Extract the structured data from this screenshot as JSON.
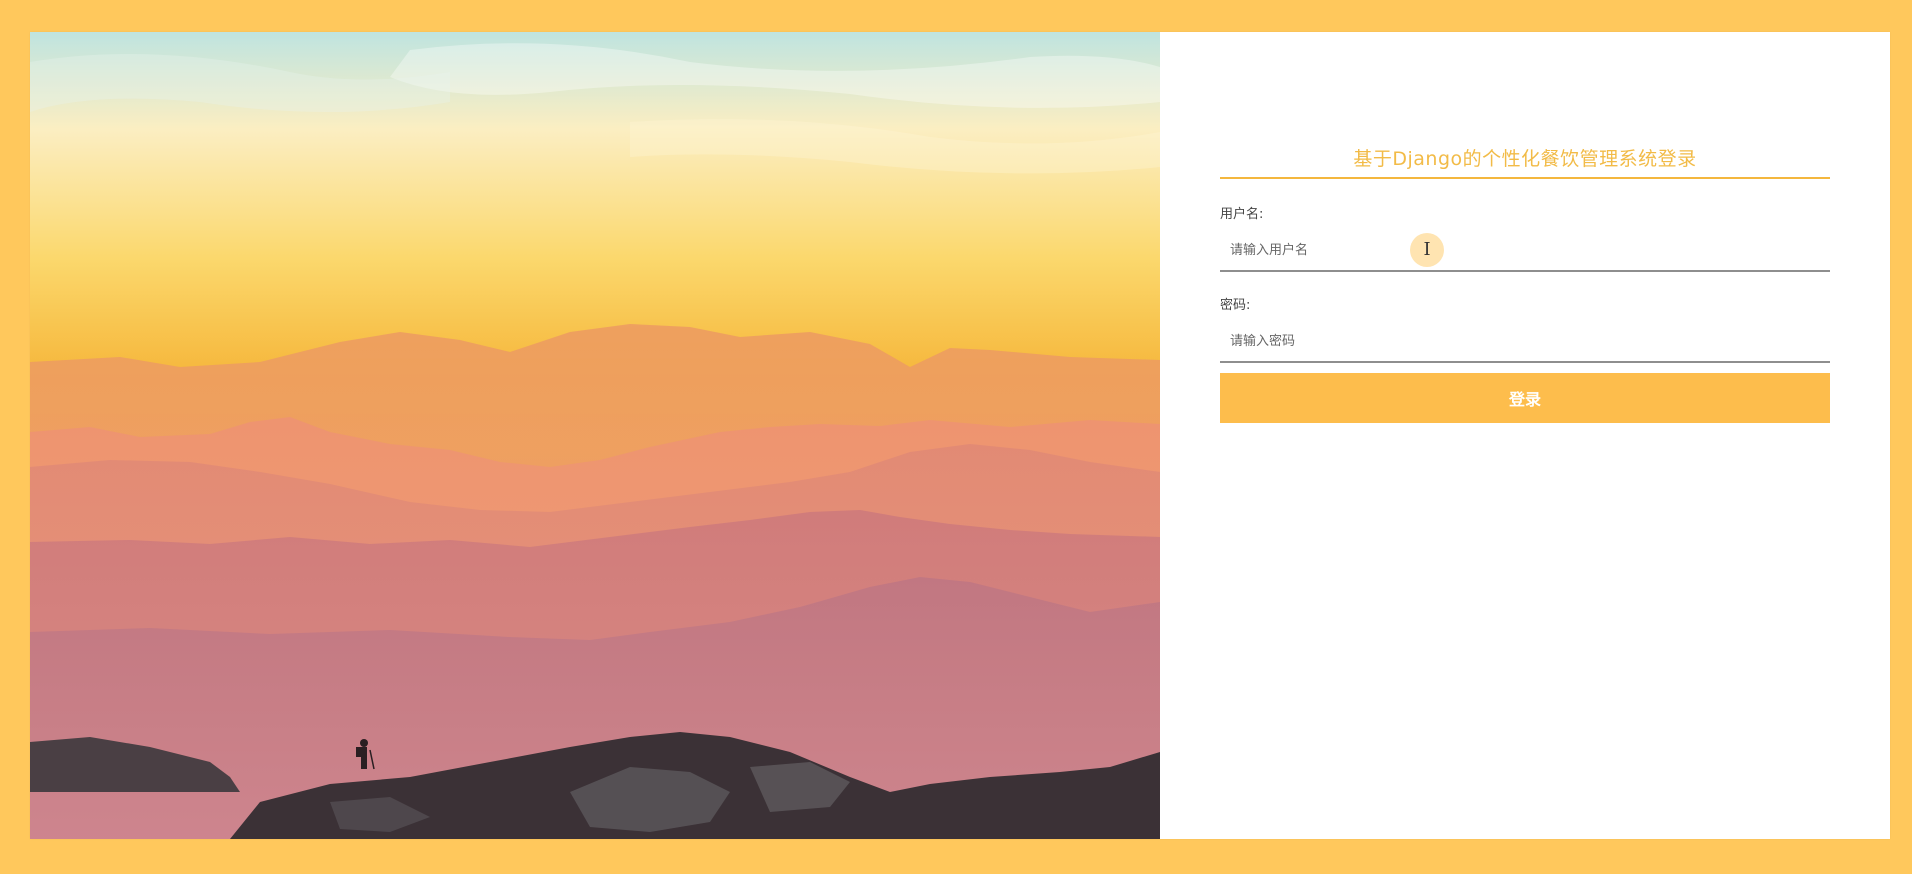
{
  "login": {
    "title": "基于Django的个性化餐饮管理系统登录",
    "username_label": "用户名:",
    "username_placeholder": "请输入用户名",
    "password_label": "密码:",
    "password_placeholder": "请输入密码",
    "submit_label": "登录"
  },
  "colors": {
    "accent": "#fdbd4c",
    "title": "#f2bb47",
    "frame": "#ffc85c"
  },
  "icons": {
    "cursor": "text-cursor-icon"
  }
}
